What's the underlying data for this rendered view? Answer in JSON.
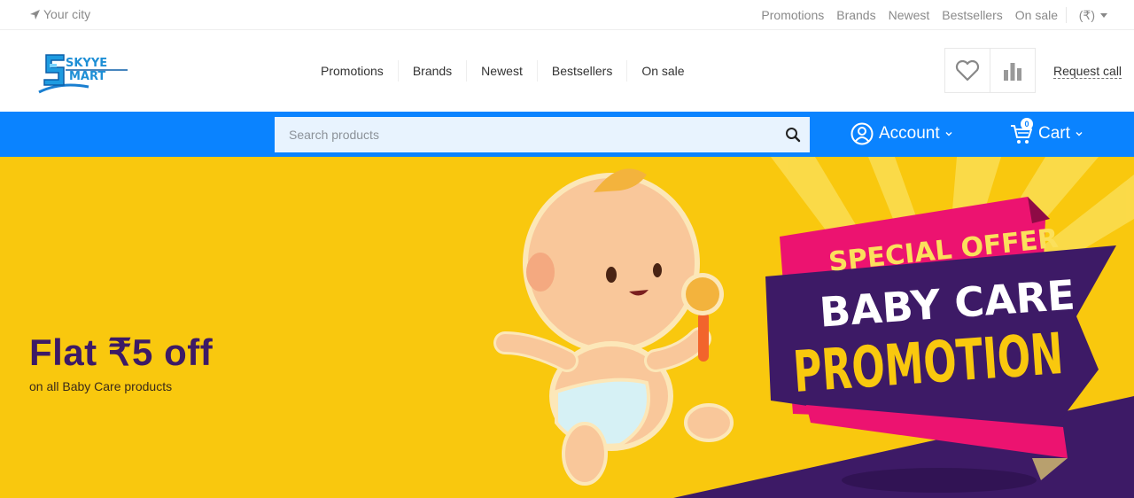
{
  "topbar": {
    "city": "Your city",
    "links": [
      "Promotions",
      "Brands",
      "Newest",
      "Bestsellers",
      "On sale"
    ],
    "currency": "(₹)"
  },
  "header": {
    "logo_text_line1": "SKYYE",
    "logo_text_line2": "MART",
    "nav": [
      "Promotions",
      "Brands",
      "Newest",
      "Bestsellers",
      "On sale"
    ],
    "request_call": "Request call"
  },
  "searchbar": {
    "placeholder": "Search products",
    "account_label": "Account",
    "cart_label": "Cart",
    "cart_count": "0"
  },
  "banner": {
    "headline": "Flat ₹5 off",
    "subline": "on all Baby Care products",
    "ribbon_top": "SPECIAL OFFER",
    "ribbon_mid": "BABY CARE",
    "ribbon_bottom": "PROMOTION"
  },
  "colors": {
    "accent_blue": "#0a83ff",
    "banner_yellow": "#f9c80e",
    "banner_purple": "#3d1a66",
    "ribbon_pink": "#ec1370"
  },
  "icons": [
    "location-arrow-icon",
    "heart-icon",
    "bar-chart-icon",
    "search-icon",
    "user-icon",
    "cart-icon",
    "chevron-down-icon"
  ]
}
